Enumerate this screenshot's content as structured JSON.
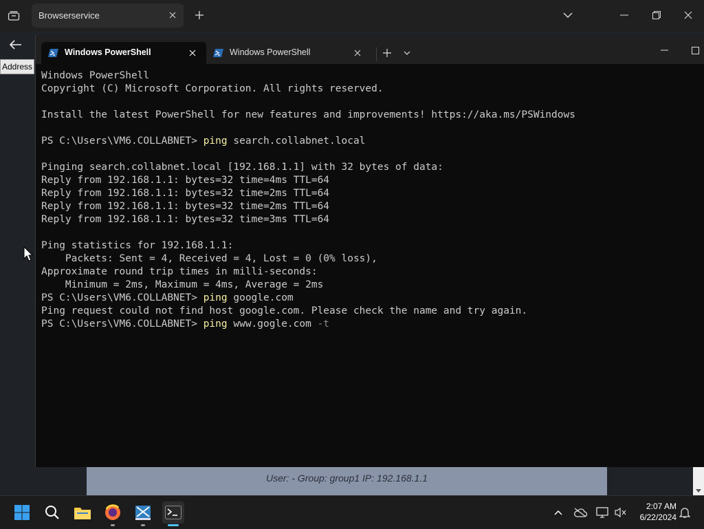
{
  "browser": {
    "tab_title": "Browserservice",
    "address_label": "Address"
  },
  "terminal": {
    "tabs": [
      {
        "title": "Windows PowerShell",
        "active": true
      },
      {
        "title": "Windows PowerShell",
        "active": false
      }
    ],
    "lines": [
      {
        "text": "Windows PowerShell"
      },
      {
        "text": "Copyright (C) Microsoft Corporation. All rights reserved."
      },
      {
        "text": ""
      },
      {
        "text": "Install the latest PowerShell for new features and improvements! https://aka.ms/PSWindows"
      },
      {
        "text": ""
      },
      {
        "prompt": "PS C:\\Users\\VM6.COLLABNET> ",
        "cmd": "ping",
        "arg": " search.collabnet.local",
        "param": ""
      },
      {
        "text": ""
      },
      {
        "text": "Pinging search.collabnet.local [192.168.1.1] with 32 bytes of data:"
      },
      {
        "text": "Reply from 192.168.1.1: bytes=32 time=4ms TTL=64"
      },
      {
        "text": "Reply from 192.168.1.1: bytes=32 time=2ms TTL=64"
      },
      {
        "text": "Reply from 192.168.1.1: bytes=32 time=2ms TTL=64"
      },
      {
        "text": "Reply from 192.168.1.1: bytes=32 time=3ms TTL=64"
      },
      {
        "text": ""
      },
      {
        "text": "Ping statistics for 192.168.1.1:"
      },
      {
        "text": "    Packets: Sent = 4, Received = 4, Lost = 0 (0% loss),"
      },
      {
        "text": "Approximate round trip times in milli-seconds:"
      },
      {
        "text": "    Minimum = 2ms, Maximum = 4ms, Average = 2ms"
      },
      {
        "prompt": "PS C:\\Users\\VM6.COLLABNET> ",
        "cmd": "ping",
        "arg": " google.com",
        "param": ""
      },
      {
        "text": "Ping request could not find host google.com. Please check the name and try again."
      },
      {
        "prompt": "PS C:\\Users\\VM6.COLLABNET> ",
        "cmd": "ping",
        "arg": " www.gogle.com ",
        "param": "-t"
      }
    ]
  },
  "page_status": {
    "text": "User: -   Group: group1   IP: 192.168.1.1"
  },
  "taskbar": {
    "time": "2:07 AM",
    "date": "6/22/2024",
    "accent": "#4cc2ff"
  }
}
